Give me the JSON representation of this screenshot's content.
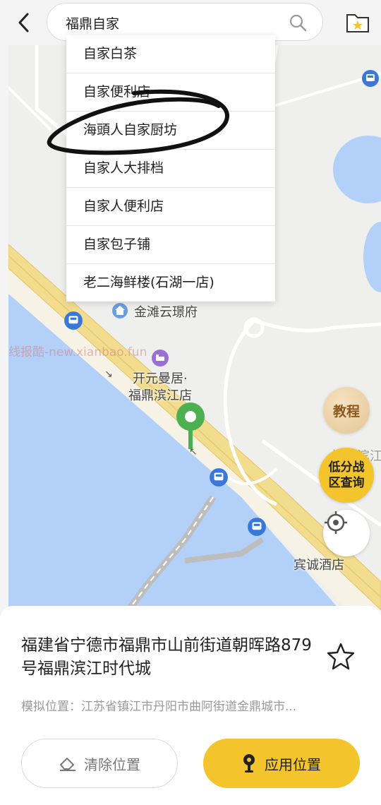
{
  "search": {
    "value": "福鼎自家",
    "suggestions": [
      "自家白茶",
      "自家便利店",
      "海頭人自家厨坊",
      "自家人大排档",
      "自家人便利店",
      "自家包子铺",
      "老二海鲜楼(石湖一店)"
    ]
  },
  "map": {
    "poi_jintan": "金滩云璟府",
    "poi_hotel_line1": "开元曼居·",
    "poi_hotel_line2": "福鼎滨江店",
    "poi_partial_right": "福鼎滨江",
    "poi_bincheng": "宾诚酒店",
    "watermark": "线报酷-new.xianbao.fun",
    "tutorial_label": "教程",
    "lowrisk_line1": "低分战",
    "lowrisk_line2": "区查询"
  },
  "panel": {
    "address": "福建省宁德市福鼎市山前街道朝晖路879号福鼎滨江时代城",
    "simulated_location": "模拟位置：江苏省镇江市丹阳市曲阿街道金鼎城市...",
    "clear_label": "清除位置",
    "apply_label": "应用位置"
  },
  "colors": {
    "accent": "#f4c42c",
    "water": "#b3d0f8",
    "road": "#f2dc8e",
    "pin": "#4caf50",
    "bus": "#3a78d8"
  },
  "icons": [
    "back-arrow-icon",
    "search-icon",
    "favorite-folder-icon",
    "bus-stop-icon",
    "hotel-icon",
    "residence-icon",
    "location-pin-icon",
    "locate-target-icon",
    "star-icon",
    "eraser-icon",
    "map-pin-icon"
  ]
}
